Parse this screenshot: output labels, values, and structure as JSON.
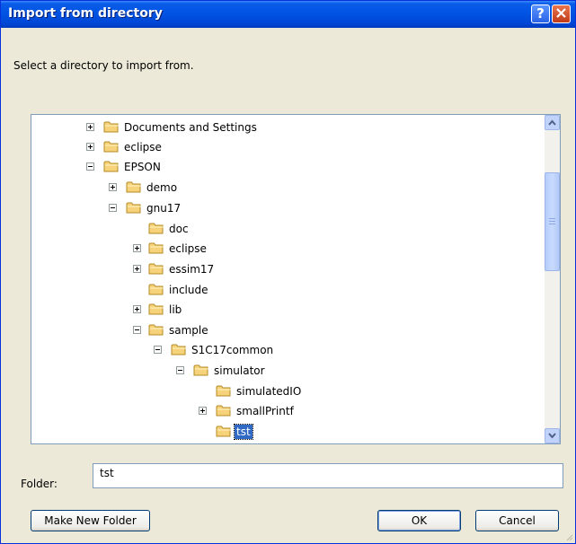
{
  "dialog": {
    "title": "Import from directory",
    "help_icon": "help-icon",
    "close_icon": "close-icon",
    "prompt": "Select a directory to import from."
  },
  "tree": {
    "nodes": [
      {
        "label": "Documents and Settings",
        "expander": "plus"
      },
      {
        "label": "eclipse",
        "expander": "plus"
      },
      {
        "label": "EPSON",
        "expander": "minus"
      },
      {
        "label": "demo",
        "expander": "plus"
      },
      {
        "label": "gnu17",
        "expander": "minus"
      },
      {
        "label": "doc",
        "expander": "none"
      },
      {
        "label": "eclipse",
        "expander": "plus"
      },
      {
        "label": "essim17",
        "expander": "plus"
      },
      {
        "label": "include",
        "expander": "none"
      },
      {
        "label": "lib",
        "expander": "plus"
      },
      {
        "label": "sample",
        "expander": "minus"
      },
      {
        "label": "S1C17common",
        "expander": "minus"
      },
      {
        "label": "simulator",
        "expander": "minus"
      },
      {
        "label": "simulatedIO",
        "expander": "none"
      },
      {
        "label": "smallPrintf",
        "expander": "plus"
      },
      {
        "label": "tst",
        "expander": "none",
        "selected": true
      }
    ],
    "folder_icon": "folder-icon",
    "scrollbar": {
      "up_icon": "scroll-up-arrow-icon",
      "down_icon": "scroll-down-arrow-icon"
    }
  },
  "folder_field": {
    "label": "Folder:",
    "value": "tst"
  },
  "buttons": {
    "make_new_folder": "Make New Folder",
    "ok": "OK",
    "cancel": "Cancel"
  },
  "colors": {
    "titlebar": "#0054e3",
    "dialog_bg": "#ece9d8",
    "selection": "#316ac5",
    "folder": "#f6d27a"
  }
}
